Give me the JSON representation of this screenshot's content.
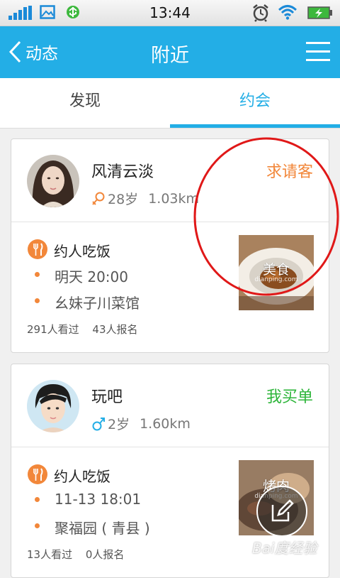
{
  "status_bar": {
    "time": "13:44"
  },
  "title_bar": {
    "back_label": "动态",
    "title": "附近"
  },
  "tabs": [
    {
      "label": "发现"
    },
    {
      "label": "约会"
    }
  ],
  "colors": {
    "accent": "#23aee6",
    "orange": "#f2873a",
    "green": "#2db53a"
  },
  "posts": [
    {
      "username": "风清云淡",
      "gender": "female",
      "age": "28岁",
      "distance": "1.03km",
      "badge": "求请客",
      "badge_color": "#f2873a",
      "activity": "约人吃饭",
      "time": "明天 20:00",
      "place": "幺妹子川菜馆",
      "views": "291人看过",
      "signups": "43人报名",
      "thumb_label": "美食",
      "thumb_sub": "dianping.com"
    },
    {
      "username": "玩吧",
      "gender": "male",
      "age": "2岁",
      "distance": "1.60km",
      "badge": "我买单",
      "badge_color": "#2db53a",
      "activity": "约人吃饭",
      "time": "11-13 18:01",
      "place": "聚福园 ( 青县 )",
      "views": "13人看过",
      "signups": "0人报名",
      "thumb_label": "烤肉",
      "thumb_sub": "dianping.com"
    }
  ],
  "watermark": "Bai度经验"
}
